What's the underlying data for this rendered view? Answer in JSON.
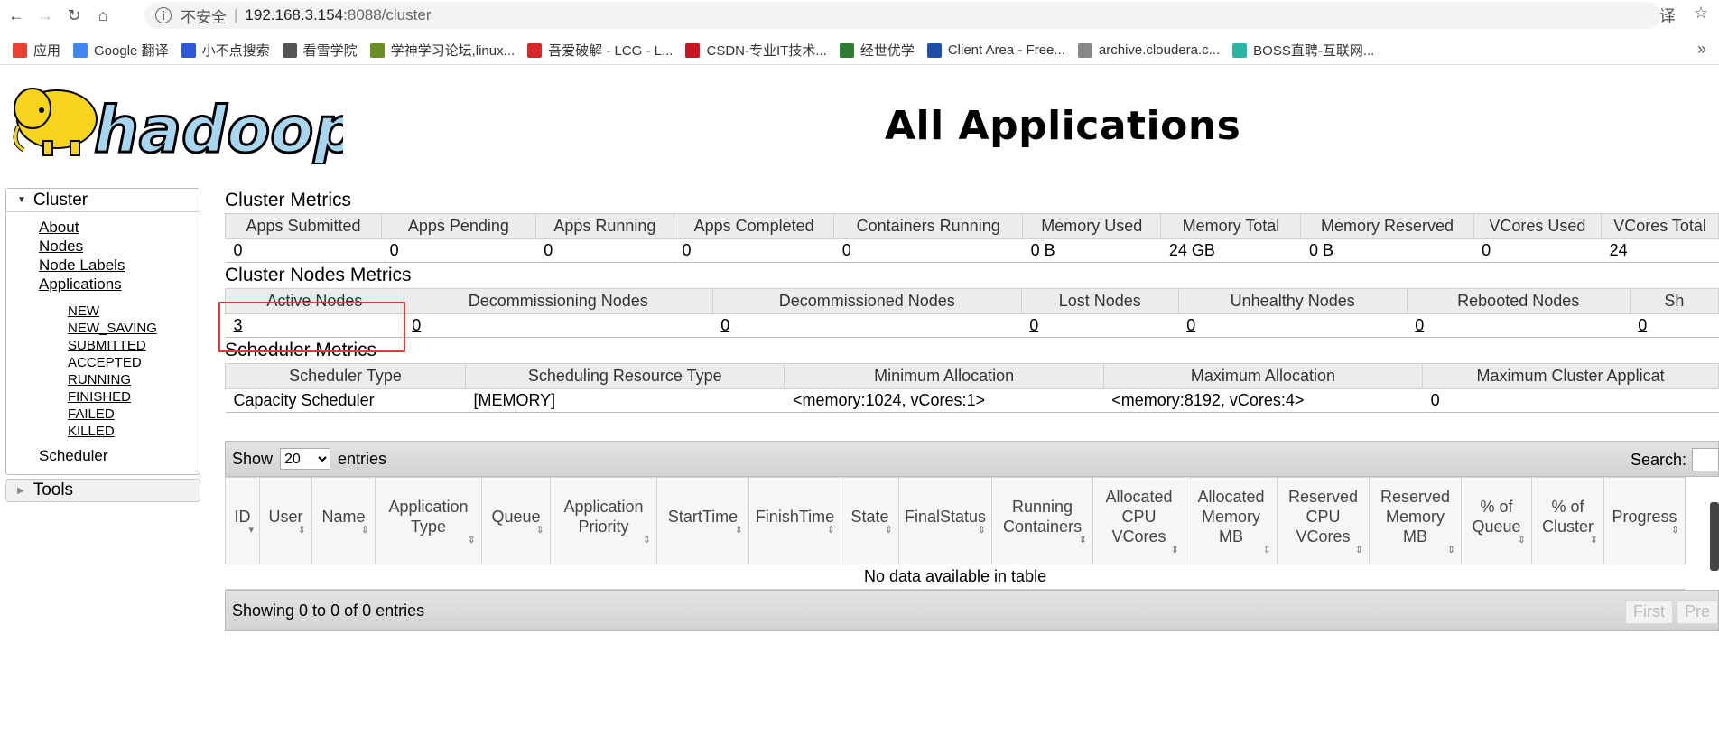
{
  "browser": {
    "insecure_label": "不安全",
    "url_host": "192.168.3.154",
    "url_path": ":8088/cluster",
    "bookmarks": [
      {
        "label": "应用",
        "color": "#e94235"
      },
      {
        "label": "Google 翻译",
        "color": "#4285f4"
      },
      {
        "label": "小不点搜索",
        "color": "#2b59d9"
      },
      {
        "label": "看雪学院",
        "color": "#555555"
      },
      {
        "label": "学神学习论坛,linux...",
        "color": "#6b8e23"
      },
      {
        "label": "吾爱破解 - LCG - L...",
        "color": "#d62828"
      },
      {
        "label": "CSDN-专业IT技术...",
        "color": "#c81623"
      },
      {
        "label": "经世优学",
        "color": "#2e7d32"
      },
      {
        "label": "Client Area - Free...",
        "color": "#1f4fa8"
      },
      {
        "label": "archive.cloudera.c...",
        "color": "#888888"
      },
      {
        "label": "BOSS直聘-互联网...",
        "color": "#2bb5a5"
      }
    ],
    "more_label": "»"
  },
  "page": {
    "logo_text": "hadoop",
    "title": "All Applications"
  },
  "sidebar": {
    "cluster_label": "Cluster",
    "links": [
      "About",
      "Nodes",
      "Node Labels",
      "Applications"
    ],
    "app_states": [
      "NEW",
      "NEW_SAVING",
      "SUBMITTED",
      "ACCEPTED",
      "RUNNING",
      "FINISHED",
      "FAILED",
      "KILLED"
    ],
    "scheduler_label": "Scheduler",
    "tools_label": "Tools"
  },
  "cluster_metrics": {
    "title": "Cluster Metrics",
    "headers": [
      "Apps Submitted",
      "Apps Pending",
      "Apps Running",
      "Apps Completed",
      "Containers Running",
      "Memory Used",
      "Memory Total",
      "Memory Reserved",
      "VCores Used",
      "VCores Total"
    ],
    "values": [
      "0",
      "0",
      "0",
      "0",
      "0",
      "0 B",
      "24 GB",
      "0 B",
      "0",
      "24"
    ]
  },
  "nodes_metrics": {
    "title": "Cluster Nodes Metrics",
    "headers": [
      "Active Nodes",
      "Decommissioning Nodes",
      "Decommissioned Nodes",
      "Lost Nodes",
      "Unhealthy Nodes",
      "Rebooted Nodes",
      "Sh"
    ],
    "values": [
      "3",
      "0",
      "0",
      "0",
      "0",
      "0",
      "0"
    ]
  },
  "scheduler_metrics": {
    "title": "Scheduler Metrics",
    "headers": [
      "Scheduler Type",
      "Scheduling Resource Type",
      "Minimum Allocation",
      "Maximum Allocation",
      "Maximum Cluster Applicat"
    ],
    "values": [
      "Capacity Scheduler",
      "[MEMORY]",
      "<memory:1024, vCores:1>",
      "<memory:8192, vCores:4>",
      "0"
    ]
  },
  "apps_table": {
    "show_label": "Show",
    "page_size": "20",
    "entries_label": "entries",
    "search_label": "Search:",
    "columns": [
      "ID",
      "User",
      "Name",
      "Application Type",
      "Queue",
      "Application Priority",
      "StartTime",
      "FinishTime",
      "State",
      "FinalStatus",
      "Running Containers",
      "Allocated CPU VCores",
      "Allocated Memory MB",
      "Reserved CPU VCores",
      "Reserved Memory MB",
      "% of Queue",
      "% of Cluster",
      "Progress"
    ],
    "empty_message": "No data available in table",
    "info": "Showing 0 to 0 of 0 entries",
    "first_label": "First",
    "prev_label": "Pre"
  }
}
